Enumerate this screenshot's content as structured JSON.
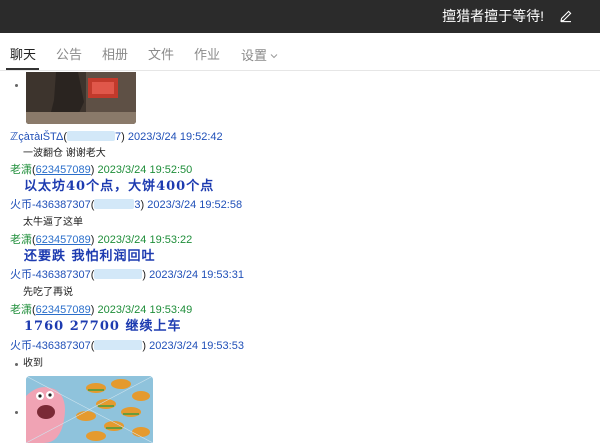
{
  "window": {
    "title": "擅猎者擅于等待!",
    "edit_icon": "pencil-icon"
  },
  "tabs": [
    {
      "label": "聊天",
      "active": true
    },
    {
      "label": "公告",
      "active": false
    },
    {
      "label": "相册",
      "active": false
    },
    {
      "label": "文件",
      "active": false
    },
    {
      "label": "作业",
      "active": false
    },
    {
      "label": "设置",
      "active": false
    }
  ],
  "messages": [
    {
      "sender": "ℤçàτàιŠΤΔ",
      "qq_visible": "7",
      "time": "2023/3/24 19:52:42",
      "text": "一波翻仓 谢谢老大"
    },
    {
      "sender": "老潇",
      "qq_visible": "623457089",
      "time": "2023/3/24 19:52:50",
      "text": "以太坊40个点，大饼400个点"
    },
    {
      "sender": "火币-436387307",
      "qq_visible": "3",
      "time": "2023/3/24 19:52:58",
      "text": "太牛逼了这单"
    },
    {
      "sender": "老潇",
      "qq_visible": "623457089",
      "time": "2023/3/24 19:53:22",
      "text": "还要跌  我怕利润回吐"
    },
    {
      "sender": "火币-436387307",
      "qq_visible": "",
      "time": "2023/3/24 19:53:31",
      "text": "先吃了再说"
    },
    {
      "sender": "老潇",
      "qq_visible": "623457089",
      "time": "2023/3/24 19:53:49",
      "text": "1760    27700    继续上车"
    },
    {
      "sender": "火币-436387307",
      "qq_visible": "",
      "time": "2023/3/24 19:53:53",
      "text": "收到"
    }
  ],
  "colors": {
    "titlebar": "#2b2b2b",
    "sender_blue": "#2050b8",
    "sender_green": "#1f8e3a",
    "highlight_text": "#1d3bb0"
  }
}
